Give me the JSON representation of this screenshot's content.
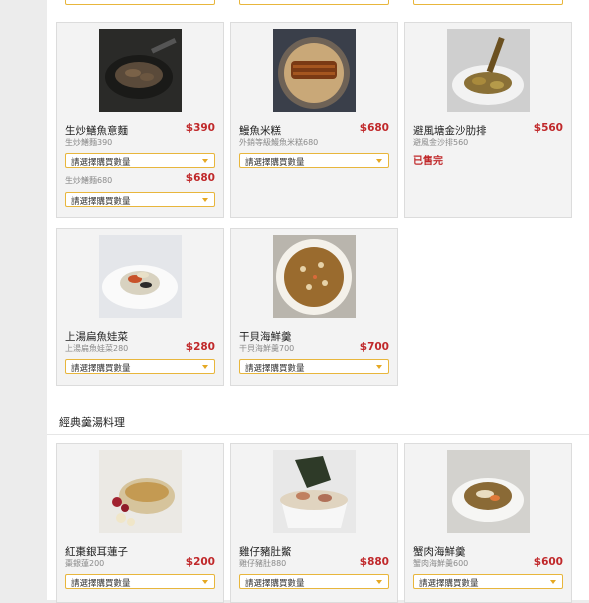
{
  "select_placeholder": "請選擇購買數量",
  "section_title": "經典羹湯料理",
  "cards": [
    {
      "name": "生炒鱔魚意麵",
      "price": "$390",
      "sub": "生炒鱔麵390",
      "price2": "$680",
      "sub2": "生炒鱔麵680"
    },
    {
      "name": "鰻魚米糕",
      "price": "$680",
      "sub": "外銷等級鰻魚米糕680"
    },
    {
      "name": "避風塘金沙肋排",
      "price": "$560",
      "sub": "避風金沙排560",
      "status": "已售完"
    },
    {
      "name": "上湯扁魚娃菜",
      "price": "$280",
      "sub": "上湯扁魚娃菜280"
    },
    {
      "name": "干貝海鮮羹",
      "price": "$700",
      "sub": "干貝海鮮羹700"
    },
    {
      "name": "紅棗銀耳蓮子",
      "price": "$200",
      "sub": "棗銀蓮200"
    },
    {
      "name": "雞仔豬肚鱉",
      "price": "$880",
      "sub": "雞仔豬肚880"
    },
    {
      "name": "蟹肉海鮮羹",
      "price": "$600",
      "sub": "蟹肉海鮮羹600"
    }
  ],
  "colors": {
    "accent": "#e8b63c",
    "price": "#c0282a"
  }
}
